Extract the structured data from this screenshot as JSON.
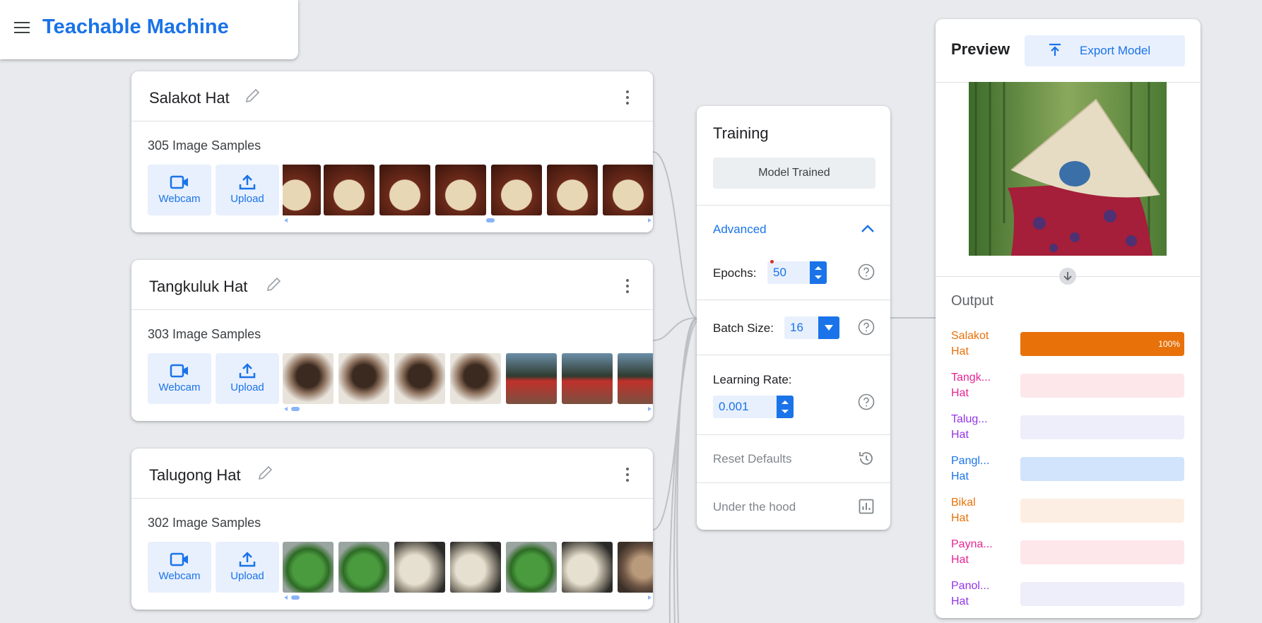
{
  "app": {
    "title": "Teachable Machine"
  },
  "classes": [
    {
      "name": "Salakot Hat",
      "samples": "305 Image Samples",
      "webcam": "Webcam",
      "upload": "Upload"
    },
    {
      "name": "Tangkuluk Hat",
      "samples": "303 Image Samples",
      "webcam": "Webcam",
      "upload": "Upload"
    },
    {
      "name": "Talugong Hat",
      "samples": "302 Image Samples",
      "webcam": "Webcam",
      "upload": "Upload"
    }
  ],
  "training": {
    "title": "Training",
    "status": "Model Trained",
    "advanced": "Advanced",
    "epochs_label": "Epochs:",
    "epochs_value": "50",
    "batch_label": "Batch Size:",
    "batch_value": "16",
    "lr_label": "Learning Rate:",
    "lr_value": "0.001",
    "reset": "Reset Defaults",
    "under_hood": "Under the hood"
  },
  "preview": {
    "title": "Preview",
    "export": "Export Model",
    "output_title": "Output",
    "outputs": [
      {
        "name": "Salakot\nHat",
        "color": "#e8710a",
        "bg": "#e8710a",
        "percent": 1.0,
        "label": "100%"
      },
      {
        "name": "Tangk...\nHat",
        "color": "#e52592",
        "bg": "#fde7ea",
        "percent": 0,
        "label": ""
      },
      {
        "name": "Talug...\nHat",
        "color": "#9334e6",
        "bg": "#eeedfa",
        "percent": 0,
        "label": ""
      },
      {
        "name": "Pangl...\nHat",
        "color": "#1a73e8",
        "bg": "#d2e3fc",
        "percent": 0,
        "label": ""
      },
      {
        "name": "Bikal\nHat",
        "color": "#e8710a",
        "bg": "#fdeee3",
        "percent": 0,
        "label": ""
      },
      {
        "name": "Payna...\nHat",
        "color": "#e52592",
        "bg": "#fde7ea",
        "percent": 0,
        "label": ""
      },
      {
        "name": "Panol...\nHat",
        "color": "#9334e6",
        "bg": "#eeedfa",
        "percent": 0,
        "label": ""
      }
    ]
  }
}
